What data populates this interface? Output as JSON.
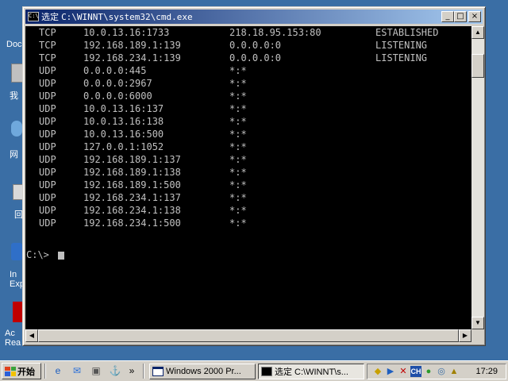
{
  "desktop": {
    "icons": [
      {
        "label": "Doc",
        "icon": "documents-icon"
      },
      {
        "label": "我",
        "icon": "computer-icon"
      },
      {
        "label": "网",
        "icon": "network-icon"
      },
      {
        "label": "回",
        "icon": "recycle-bin-icon"
      },
      {
        "label": "In\nExp",
        "icon": "internet-explorer-icon"
      },
      {
        "label": "Ac\nRea",
        "icon": "acrobat-reader-icon"
      }
    ]
  },
  "window": {
    "title_prefix": "选定",
    "title_path": "C:\\WINNT\\system32\\cmd.exe",
    "buttons": {
      "minimize": "_",
      "maximize": "□",
      "close": "×"
    }
  },
  "console": {
    "rows": [
      [
        "TCP",
        "10.0.13.16:1733",
        "218.18.95.153:80",
        "ESTABLISHED"
      ],
      [
        "TCP",
        "192.168.189.1:139",
        "0.0.0.0:0",
        "LISTENING"
      ],
      [
        "TCP",
        "192.168.234.1:139",
        "0.0.0.0:0",
        "LISTENING"
      ],
      [
        "UDP",
        "0.0.0.0:445",
        "*:*",
        ""
      ],
      [
        "UDP",
        "0.0.0.0:2967",
        "*:*",
        ""
      ],
      [
        "UDP",
        "0.0.0.0:6000",
        "*:*",
        ""
      ],
      [
        "UDP",
        "10.0.13.16:137",
        "*:*",
        ""
      ],
      [
        "UDP",
        "10.0.13.16:138",
        "*:*",
        ""
      ],
      [
        "UDP",
        "10.0.13.16:500",
        "*:*",
        ""
      ],
      [
        "UDP",
        "127.0.0.1:1052",
        "*:*",
        ""
      ],
      [
        "UDP",
        "192.168.189.1:137",
        "*:*",
        ""
      ],
      [
        "UDP",
        "192.168.189.1:138",
        "*:*",
        ""
      ],
      [
        "UDP",
        "192.168.189.1:500",
        "*:*",
        ""
      ],
      [
        "UDP",
        "192.168.234.1:137",
        "*:*",
        ""
      ],
      [
        "UDP",
        "192.168.234.1:138",
        "*:*",
        ""
      ],
      [
        "UDP",
        "192.168.234.1:500",
        "*:*",
        ""
      ]
    ],
    "prompt": "C:\\>"
  },
  "taskbar": {
    "start_label": "开始",
    "tasks": [
      {
        "label": "Windows 2000 Pr...",
        "icon": "window-icon",
        "active": false
      },
      {
        "label": "选定 C:\\WINNT\\s...",
        "icon": "cmd-icon",
        "active": true
      }
    ],
    "tray": {
      "ime": "CH",
      "clock": "17:29"
    }
  },
  "colors": {
    "desktop": "#3a6ea5",
    "title_active": "#0a246a",
    "console_bg": "#000000",
    "console_fg": "#c0c0c0"
  }
}
